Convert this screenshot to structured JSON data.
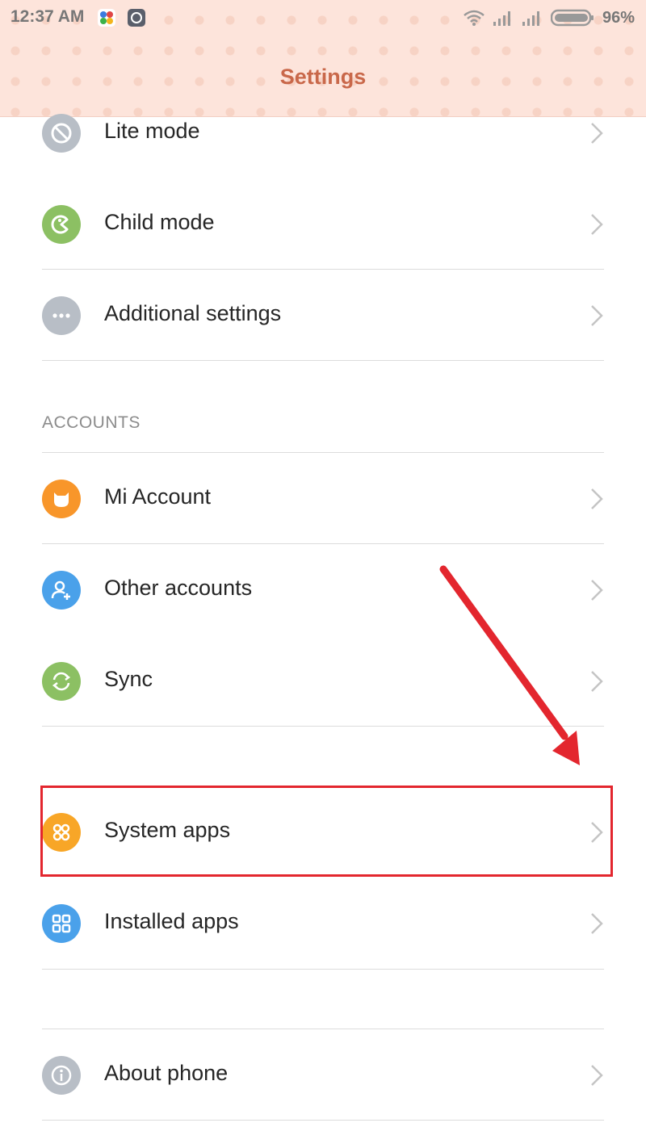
{
  "status_bar": {
    "time": "12:37 AM",
    "battery": "96%",
    "icons": [
      "app-notification-icon",
      "app-notification-icon-2",
      "wifi-icon",
      "signal-icon",
      "signal-icon-2",
      "battery-icon"
    ]
  },
  "header": {
    "title": "Settings"
  },
  "rows": {
    "lite_mode": "Lite mode",
    "child_mode": "Child mode",
    "additional_settings": "Additional settings",
    "mi_account": "Mi Account",
    "other_accounts": "Other accounts",
    "sync": "Sync",
    "system_apps": "System apps",
    "installed_apps": "Installed apps",
    "about_phone": "About phone"
  },
  "sections": {
    "accounts": "ACCOUNTS"
  },
  "colors": {
    "header_bg": "#fde4db",
    "title": "#c9684a",
    "gray_icon": "#b8bec6",
    "green_icon": "#8cc063",
    "orange_icon": "#f8962a",
    "blue_icon": "#4aa1ea",
    "annotation_red": "#e3262e"
  }
}
